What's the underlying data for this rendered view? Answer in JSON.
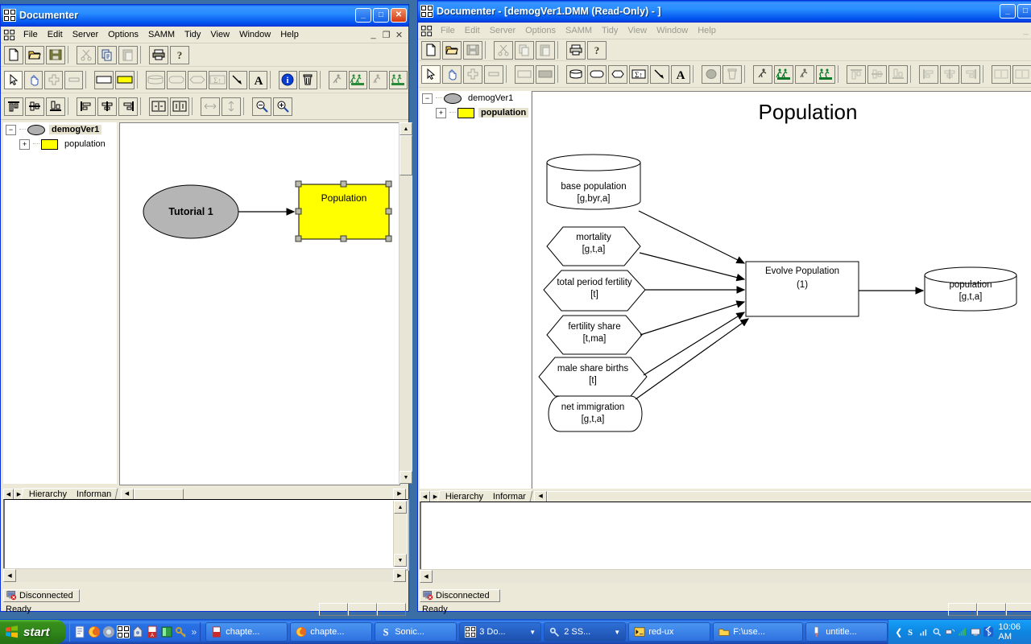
{
  "left_window": {
    "title": "Documenter",
    "app_icon": "documenter-icon",
    "buttons": {
      "minimize": "_",
      "maximize": "□",
      "close": "✕"
    },
    "menu": [
      "File",
      "Edit",
      "Server",
      "Options",
      "SAMM",
      "Tidy",
      "View",
      "Window",
      "Help"
    ],
    "mdi_buttons": [
      "_",
      "❐",
      "✕"
    ],
    "toolbar_file": [
      {
        "name": "new-icon",
        "glyph": "new"
      },
      {
        "name": "open-icon",
        "glyph": "open"
      },
      {
        "name": "save-icon",
        "glyph": "save"
      },
      {
        "name": "cut-icon",
        "glyph": "cut"
      },
      {
        "name": "copy-icon",
        "glyph": "copy"
      },
      {
        "name": "paste-icon",
        "glyph": "paste"
      },
      {
        "name": "print-icon",
        "glyph": "print"
      },
      {
        "name": "help-icon",
        "glyph": "help"
      }
    ],
    "toolbar_draw": [
      {
        "name": "select-arrow-icon",
        "glyph": "arrow",
        "state": "pressed"
      },
      {
        "name": "pan-hand-icon",
        "glyph": "hand"
      },
      {
        "name": "add-plus-icon",
        "glyph": "plus",
        "state": "disabled"
      },
      {
        "name": "remove-minus-icon",
        "glyph": "minus",
        "state": "disabled"
      },
      {
        "name": "rectangle-icon",
        "glyph": "rect"
      },
      {
        "name": "yellow-rectangle-icon",
        "glyph": "rect-yellow"
      },
      {
        "name": "cylinder-icon",
        "glyph": "cylinder",
        "state": "disabled"
      },
      {
        "name": "rounded-rect-icon",
        "glyph": "rounded",
        "state": "disabled"
      },
      {
        "name": "hexagon-icon",
        "glyph": "hexagon",
        "state": "disabled"
      },
      {
        "name": "sigma-box-icon",
        "glyph": "sigma",
        "state": "disabled"
      },
      {
        "name": "arrow-link-icon",
        "glyph": "link"
      },
      {
        "name": "text-tool-icon",
        "glyph": "text"
      },
      {
        "name": "info-icon",
        "glyph": "info"
      },
      {
        "name": "delete-trash-icon",
        "glyph": "trash"
      },
      {
        "name": "run-icon",
        "glyph": "runner",
        "state": "disabled"
      },
      {
        "name": "run-all-icon",
        "glyph": "runners",
        "state": "disabled"
      },
      {
        "name": "run-step-icon",
        "glyph": "runner2",
        "state": "disabled"
      },
      {
        "name": "run-all-step-icon",
        "glyph": "runners2",
        "state": "disabled"
      }
    ],
    "toolbar_layout": [
      {
        "name": "align-top-icon",
        "glyph": "aligntop"
      },
      {
        "name": "align-middle-icon",
        "glyph": "alignmid"
      },
      {
        "name": "align-bottom-icon",
        "glyph": "alignbot"
      },
      {
        "name": "align-left-icon",
        "glyph": "alignleft"
      },
      {
        "name": "align-center-icon",
        "glyph": "aligncenter"
      },
      {
        "name": "align-right-icon",
        "glyph": "alignright"
      },
      {
        "name": "space-horizontal-icon",
        "glyph": "spaceh"
      },
      {
        "name": "space-vertical-icon",
        "glyph": "spacev"
      },
      {
        "name": "size-width-icon",
        "glyph": "sizew",
        "state": "disabled"
      },
      {
        "name": "size-height-icon",
        "glyph": "sizeh",
        "state": "disabled"
      },
      {
        "name": "zoom-out-icon",
        "glyph": "zoomout"
      },
      {
        "name": "zoom-in-icon",
        "glyph": "zoomin"
      }
    ],
    "tree": [
      {
        "label": "demogVer1",
        "icon": "ellipse-gray-icon",
        "expander": "−",
        "selected": true,
        "level": 0
      },
      {
        "label": "population",
        "icon": "rect-yellow-icon",
        "expander": "+",
        "selected": false,
        "level": 1
      }
    ],
    "canvas": {
      "nodes": [
        {
          "name": "tutorial-1-node",
          "shape": "ellipse",
          "label": "Tutorial 1",
          "fill": "#b5b5b5"
        },
        {
          "name": "population-node",
          "shape": "rect",
          "label": "Population",
          "fill": "#ffff00",
          "selected": true
        }
      ]
    },
    "tabs": [
      "Hierarchy",
      "Informan"
    ],
    "status": {
      "connection": "Disconnected",
      "message": "Ready"
    }
  },
  "right_window": {
    "title": "Documenter  - [demogVer1.DMM (Read-Only) - ]",
    "app_icon": "documenter-icon",
    "buttons": {
      "minimize": "_",
      "maximize": "□"
    },
    "menu": [
      "File",
      "Edit",
      "Server",
      "Options",
      "SAMM",
      "Tidy",
      "View",
      "Window",
      "Help"
    ],
    "menu_disabled": true,
    "toolbar_file": [
      {
        "name": "new-icon",
        "glyph": "new"
      },
      {
        "name": "open-icon",
        "glyph": "open"
      },
      {
        "name": "save-icon",
        "glyph": "save",
        "state": "disabled"
      },
      {
        "name": "cut-icon",
        "glyph": "cut",
        "state": "disabled"
      },
      {
        "name": "copy-icon",
        "glyph": "copy",
        "state": "disabled"
      },
      {
        "name": "paste-icon",
        "glyph": "paste",
        "state": "disabled"
      },
      {
        "name": "print-icon",
        "glyph": "print"
      },
      {
        "name": "help-icon",
        "glyph": "help"
      }
    ],
    "toolbar_draw": [
      {
        "name": "select-arrow-icon",
        "glyph": "arrow",
        "state": "pressed"
      },
      {
        "name": "pan-hand-icon",
        "glyph": "hand"
      },
      {
        "name": "add-plus-icon",
        "glyph": "plus",
        "state": "disabled"
      },
      {
        "name": "remove-minus-icon",
        "glyph": "minus",
        "state": "disabled"
      },
      {
        "name": "rectangle-icon",
        "glyph": "rect",
        "state": "disabled"
      },
      {
        "name": "filled-rectangle-icon",
        "glyph": "rect-gray",
        "state": "disabled"
      },
      {
        "name": "cylinder-icon",
        "glyph": "cylinder"
      },
      {
        "name": "rounded-rect-icon",
        "glyph": "rounded"
      },
      {
        "name": "hexagon-icon",
        "glyph": "hexagon"
      },
      {
        "name": "sigma-box-icon",
        "glyph": "sigma"
      },
      {
        "name": "arrow-link-icon",
        "glyph": "link"
      },
      {
        "name": "text-tool-icon",
        "glyph": "text"
      },
      {
        "name": "ellipse-filled-icon",
        "glyph": "ellipse-gray",
        "state": "disabled"
      },
      {
        "name": "delete-trash-icon",
        "glyph": "trash",
        "state": "disabled"
      },
      {
        "name": "run-icon",
        "glyph": "runner"
      },
      {
        "name": "run-all-icon",
        "glyph": "runners"
      },
      {
        "name": "run-step-icon",
        "glyph": "runner2"
      },
      {
        "name": "run-all-step-icon",
        "glyph": "runners2"
      },
      {
        "name": "align-top-icon",
        "glyph": "aligntop",
        "state": "disabled"
      },
      {
        "name": "align-middle-icon",
        "glyph": "alignmid",
        "state": "disabled"
      },
      {
        "name": "align-bottom-icon",
        "glyph": "alignbot",
        "state": "disabled"
      },
      {
        "name": "align-left-icon",
        "glyph": "alignleft",
        "state": "disabled"
      },
      {
        "name": "align-center-icon",
        "glyph": "aligncenter",
        "state": "disabled"
      },
      {
        "name": "align-right-icon",
        "glyph": "alignright",
        "state": "disabled"
      },
      {
        "name": "space-horizontal-icon",
        "glyph": "spaceh",
        "state": "disabled"
      },
      {
        "name": "space-vertical-icon",
        "glyph": "spacev",
        "state": "disabled"
      }
    ],
    "tree": [
      {
        "label": "demogVer1",
        "icon": "ellipse-gray-icon",
        "expander": "−",
        "selected": false,
        "level": 0
      },
      {
        "label": "population",
        "icon": "rect-yellow-icon",
        "expander": "+",
        "selected": true,
        "level": 1
      }
    ],
    "diagram": {
      "title": "Population",
      "nodes": [
        {
          "name": "base-population-node",
          "shape": "cylinder",
          "label": "base population",
          "sublabel": "[g,byr,a]"
        },
        {
          "name": "mortality-node",
          "shape": "hexagon",
          "label": "mortality",
          "sublabel": "[g,t,a]"
        },
        {
          "name": "total-period-fertility-node",
          "shape": "hexagon",
          "label": "total period fertility",
          "sublabel": "[t]"
        },
        {
          "name": "fertility-share-node",
          "shape": "hexagon",
          "label": "fertility share",
          "sublabel": "[t,ma]"
        },
        {
          "name": "male-share-births-node",
          "shape": "hexagon",
          "label": "male share births",
          "sublabel": "[t]"
        },
        {
          "name": "net-immigration-node",
          "shape": "rounded",
          "label": "net immigration",
          "sublabel": "[g,t,a]"
        },
        {
          "name": "evolve-population-node",
          "shape": "rect",
          "label": "Evolve Population",
          "sublabel": "(1)"
        },
        {
          "name": "population-output-node",
          "shape": "cylinder",
          "label": "population",
          "sublabel": "[g,t,a]"
        }
      ]
    },
    "tabs": [
      "Hierarchy",
      "Informar"
    ],
    "status": {
      "connection": "Disconnected",
      "message": "Ready"
    }
  },
  "taskbar": {
    "start_label": "start",
    "quick_launch": [
      {
        "name": "ql-notepad-icon"
      },
      {
        "name": "ql-firefox-icon"
      },
      {
        "name": "ql-media-icon"
      },
      {
        "name": "ql-documenter-icon"
      },
      {
        "name": "ql-app-icon"
      },
      {
        "name": "ql-acrobat-icon"
      },
      {
        "name": "ql-book-icon"
      },
      {
        "name": "ql-key-icon"
      }
    ],
    "quick_launch_more": "»",
    "tasks": [
      {
        "label": "chapte...",
        "icon": "acrobat-icon",
        "grouped": false
      },
      {
        "label": "chapte...",
        "icon": "firefox-icon",
        "grouped": false
      },
      {
        "label": "Sonic...",
        "icon": "sonic-icon",
        "grouped": false
      },
      {
        "label": "3 Do...",
        "icon": "documenter-icon",
        "grouped": true
      },
      {
        "label": "2 SS...",
        "icon": "ssh-icon",
        "grouped": true
      },
      {
        "label": "red-ux",
        "icon": "terminal-icon",
        "grouped": false
      },
      {
        "label": "F:\\use...",
        "icon": "folder-icon",
        "grouped": false
      },
      {
        "label": "untitle...",
        "icon": "paint-icon",
        "grouped": false
      }
    ],
    "tray": [
      {
        "name": "tray-show-hidden-icon",
        "glyph": "‹"
      },
      {
        "name": "tray-sonic-icon",
        "glyph": "S"
      },
      {
        "name": "tray-signal-icon",
        "glyph": "bars"
      },
      {
        "name": "tray-search-icon",
        "glyph": "mag"
      },
      {
        "name": "tray-network-icon",
        "glyph": "net"
      },
      {
        "name": "tray-volume-icon",
        "glyph": "vol"
      },
      {
        "name": "tray-monitor-icon",
        "glyph": "mon"
      },
      {
        "name": "tray-bluetooth-icon",
        "glyph": "bt"
      }
    ],
    "clock": "10:06 AM"
  }
}
